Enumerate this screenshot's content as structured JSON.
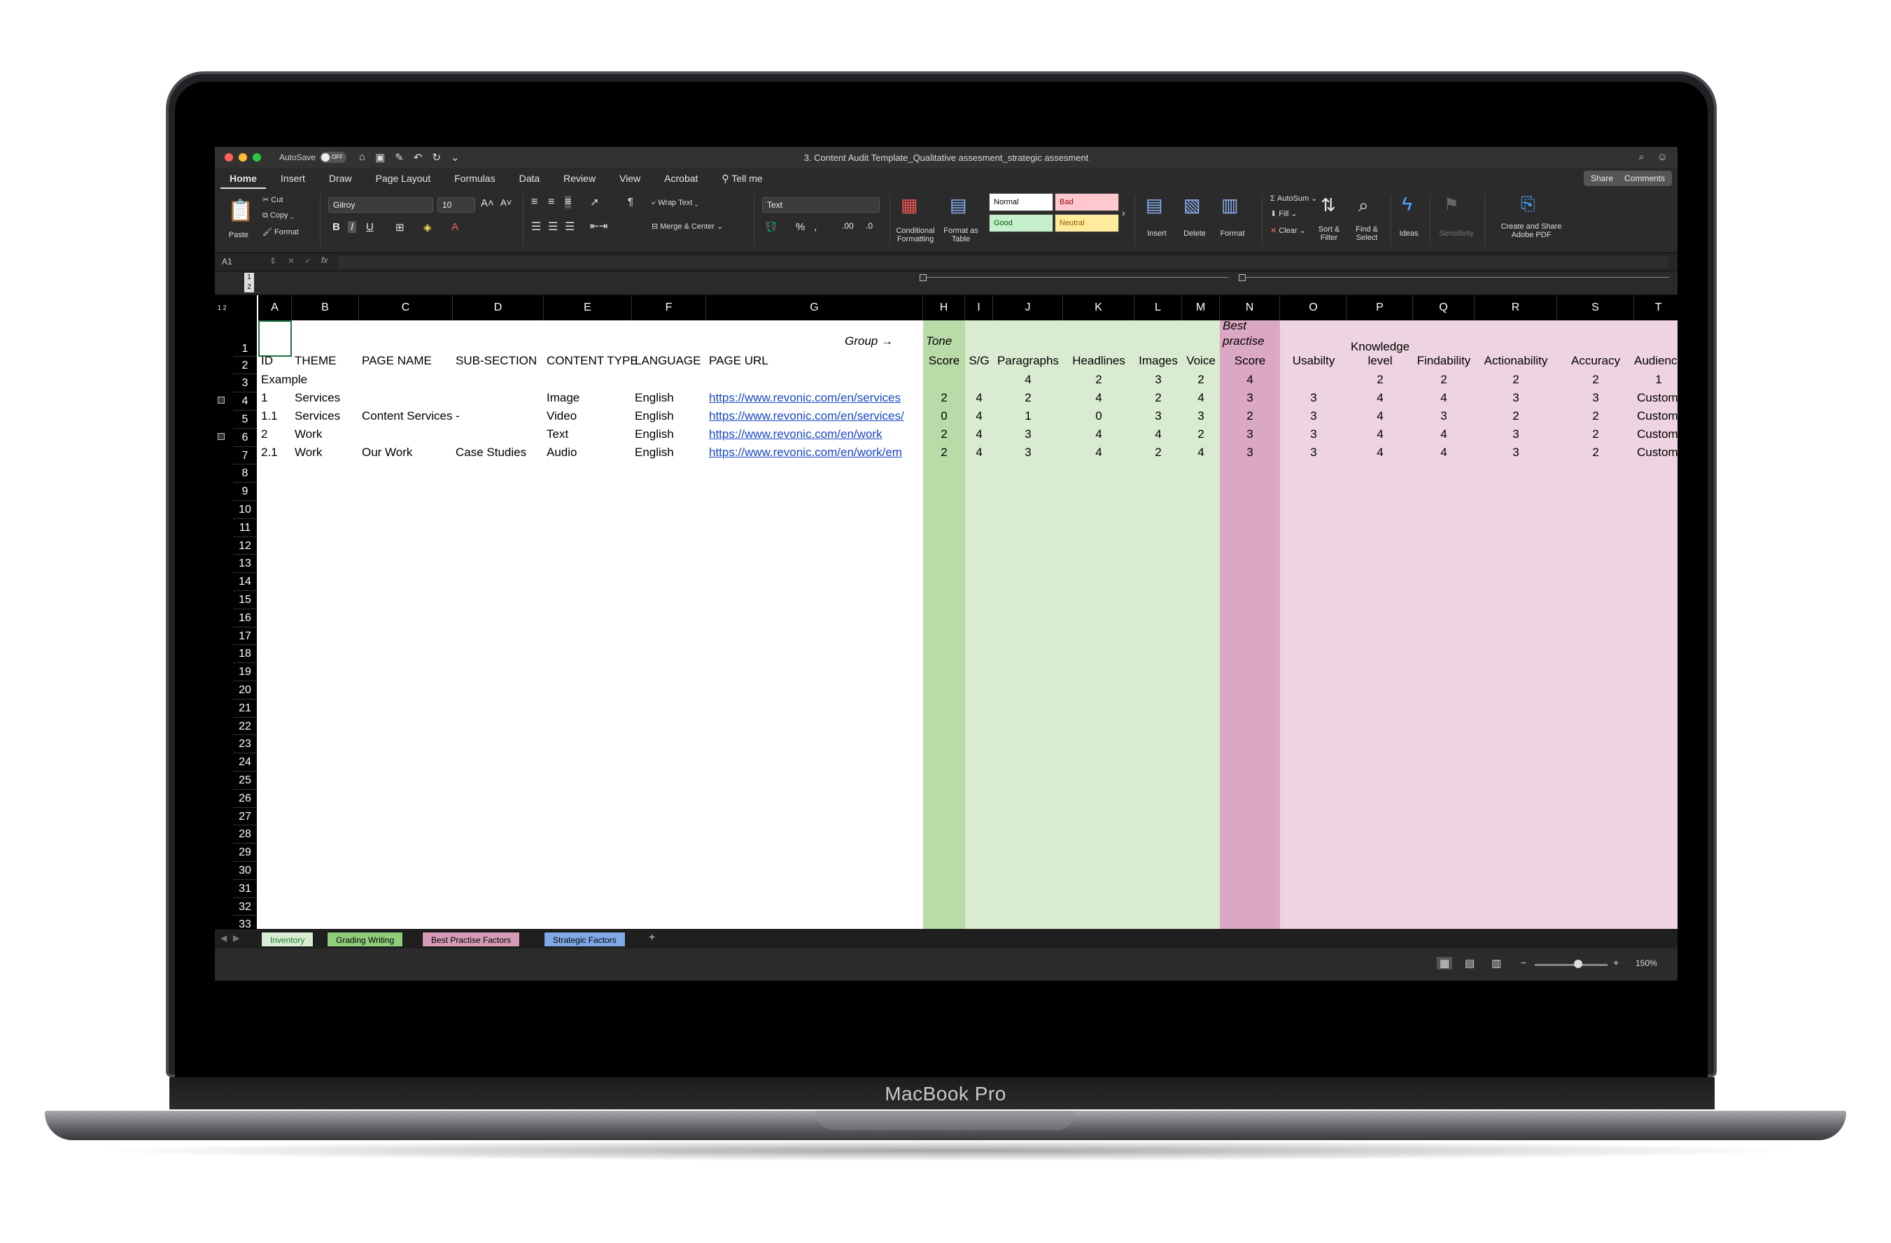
{
  "device": {
    "brand": "MacBook Pro"
  },
  "window": {
    "autosave_label": "AutoSave",
    "autosave_state": "OFF",
    "document_title": "3. Content Audit Template_Qualitative assesment_strategic assesment"
  },
  "menu": {
    "tabs": [
      "Home",
      "Insert",
      "Draw",
      "Page Layout",
      "Formulas",
      "Data",
      "Review",
      "View",
      "Acrobat"
    ],
    "tell_me": "Tell me",
    "share": "Share",
    "comments": "Comments"
  },
  "ribbon": {
    "paste": "Paste",
    "cut": "Cut",
    "copy": "Copy",
    "format": "Format",
    "font_name": "Gilroy",
    "font_size": "10",
    "wrap_text": "Wrap Text",
    "merge_center": "Merge & Center",
    "number_format": "Text",
    "conditional_formatting": "Conditional Formatting",
    "format_as_table": "Format as Table",
    "styles": {
      "normal": "Normal",
      "bad": "Bad",
      "good": "Good",
      "neutral": "Neutral"
    },
    "insert": "Insert",
    "delete": "Delete",
    "format_cells": "Format",
    "autosum": "AutoSum",
    "fill": "Fill",
    "clear": "Clear",
    "sort_filter": "Sort & Filter",
    "find_select": "Find & Select",
    "ideas": "Ideas",
    "sensitivity": "Sensitivity",
    "create_share_pdf": "Create and Share Adobe PDF"
  },
  "formula_bar": {
    "name_box": "A1",
    "fx": "fx"
  },
  "outline_levels": [
    "1",
    "2"
  ],
  "sheet": {
    "columns": [
      "A",
      "B",
      "C",
      "D",
      "E",
      "F",
      "G",
      "H",
      "I",
      "J",
      "K",
      "L",
      "M",
      "N",
      "O",
      "P",
      "Q",
      "R",
      "S",
      "T"
    ],
    "rows": [
      "1",
      "2",
      "3",
      "4",
      "5",
      "6",
      "7",
      "8",
      "9",
      "10",
      "11",
      "12",
      "13",
      "14",
      "15",
      "16",
      "17",
      "18",
      "19",
      "20",
      "21",
      "22",
      "23",
      "24",
      "25",
      "26",
      "27",
      "28",
      "29",
      "30",
      "31",
      "32",
      "33"
    ],
    "group_label": "Group →",
    "tone_label": "Tone",
    "best_practise_label_1": "Best",
    "best_practise_label_2": "practise",
    "knowledge_label_1": "Knowledge",
    "headers": [
      "ID",
      "THEME",
      "PAGE NAME",
      "SUB-SECTION",
      "CONTENT TYPE",
      "LANGUAGE",
      "PAGE URL",
      "Score",
      "S/G",
      "Paragraphs",
      "Headlines",
      "Images",
      "Voice",
      "Score",
      "Usabilty",
      "level",
      "Findability",
      "Actionability",
      "Accuracy",
      "Audience"
    ],
    "example_label": "Example",
    "example_values": [
      "",
      "4",
      "2",
      "3",
      "2",
      "4",
      "",
      "2",
      "2",
      "2",
      "2",
      "1"
    ],
    "data_rows": [
      [
        "1",
        "Services",
        "",
        "",
        "Image",
        "English",
        "https://www.revonic.com/en/services",
        "2",
        "4",
        "2",
        "4",
        "2",
        "4",
        "3",
        "3",
        "4",
        "4",
        "3",
        "3",
        "Custome"
      ],
      [
        "1.1",
        "Services",
        "Content Services",
        "-",
        "Video",
        "English",
        "https://www.revonic.com/en/services/",
        "0",
        "4",
        "1",
        "0",
        "3",
        "3",
        "2",
        "3",
        "4",
        "3",
        "2",
        "2",
        "Custome"
      ],
      [
        "2",
        "Work",
        "",
        "",
        "Text",
        "English",
        "https://www.revonic.com/en/work",
        "2",
        "4",
        "3",
        "4",
        "4",
        "2",
        "3",
        "3",
        "4",
        "4",
        "3",
        "2",
        "Custome"
      ],
      [
        "2.1",
        "Work",
        "Our Work",
        "Case Studies",
        "Audio",
        "English",
        "https://www.revonic.com/en/work/em",
        "2",
        "4",
        "3",
        "4",
        "2",
        "4",
        "3",
        "3",
        "4",
        "4",
        "3",
        "2",
        "Custome"
      ]
    ]
  },
  "sheet_tabs": [
    {
      "label": "Inventory",
      "color": "#d7ecd2",
      "text": "#1a7a2f"
    },
    {
      "label": "Grading Writing",
      "color": "#8fce7a",
      "text": "#000000"
    },
    {
      "label": "Best Practise Factors",
      "color": "#d49ab6",
      "text": "#000000"
    },
    {
      "label": "Strategic Factors",
      "color": "#7fa8e6",
      "text": "#000000"
    }
  ],
  "add_sheet": "+",
  "status": {
    "zoom": "150%",
    "zoom_minus": "−",
    "zoom_plus": "+"
  },
  "colors": {
    "tone_green": "#b9dba8",
    "grading_green": "#d9ecd1",
    "best_pink": "#dba8c4",
    "strategic_pink": "#eed3e0",
    "link_blue": "#1a47c9"
  }
}
